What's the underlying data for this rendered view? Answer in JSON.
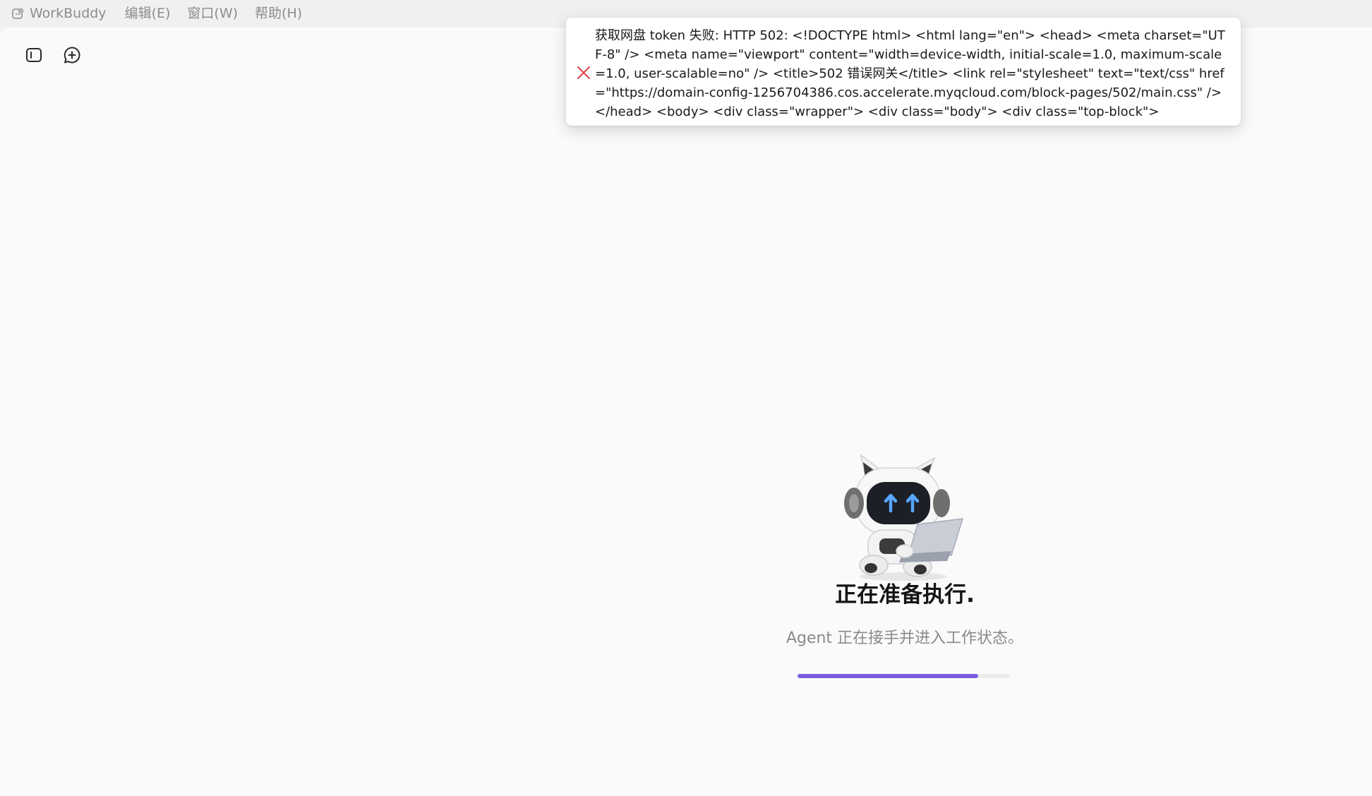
{
  "menubar": {
    "app_name": "WorkBuddy",
    "items": [
      "编辑(E)",
      "窗口(W)",
      "帮助(H)"
    ]
  },
  "toolbar": {
    "toggle_sidebar_icon": "sidebar-panel-icon",
    "new_chat_icon": "chat-plus-icon"
  },
  "toast": {
    "icon": "close-x-icon",
    "icon_color": "#e0454b",
    "message": "获取网盘 token 失败: HTTP 502: <!DOCTYPE html> <html lang=\"en\"> <head> <meta charset=\"UTF-8\" /> <meta name=\"viewport\" content=\"width=device-width, initial-scale=1.0, maximum-scale=1.0, user-scalable=no\" /> <title>502 错误网关</title> <link rel=\"stylesheet\" text=\"text/css\" href=\"https://domain-config-1256704386.cos.accelerate.myqcloud.com/block-pages/502/main.css\" /> </head> <body> <div class=\"wrapper\"> <div class=\"body\"> <div class=\"top-block\">"
  },
  "status": {
    "mascot": "robot-cat-laptop-illustration",
    "title": "正在准备执行.",
    "subtitle": "Agent 正在接手并进入工作状态。",
    "progress": 0.85,
    "progress_color": "#7c5ce0"
  }
}
